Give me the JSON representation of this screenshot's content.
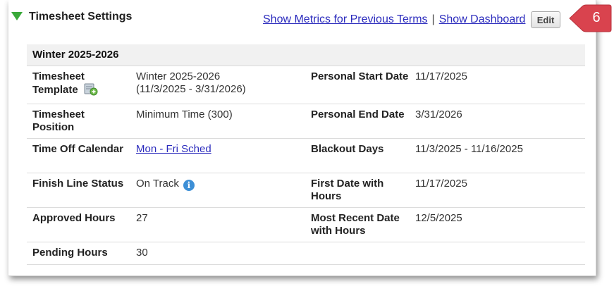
{
  "header": {
    "title": "Timesheet Settings",
    "link_metrics": "Show Metrics for Previous Terms",
    "separator": "|",
    "link_dashboard": "Show Dashboard",
    "edit_label": "Edit",
    "callout_number": "6",
    "callout_color": "#d9434e",
    "toggle_color": "#3aa93a"
  },
  "section": {
    "title": "Winter 2025-2026",
    "rows": [
      {
        "left_label": "Timesheet Template",
        "left_value_line1": "Winter 2025-2026",
        "left_value_line2": "(11/3/2025 - 3/31/2026)",
        "right_label": "Personal Start Date",
        "right_value": "11/17/2025"
      },
      {
        "left_label": "Timesheet Position",
        "left_value": "Minimum Time (300)",
        "right_label": "Personal End Date",
        "right_value": "3/31/2026"
      },
      {
        "left_label": "Time Off Calendar",
        "left_value": "Mon - Fri Sched",
        "right_label": "Blackout Days",
        "right_value": "11/3/2025 - 11/16/2025"
      },
      {
        "left_label": "Finish Line Status",
        "left_value": "On Track",
        "right_label": "First Date with Hours",
        "right_value": "11/17/2025"
      },
      {
        "left_label": "Approved Hours",
        "left_value": "27",
        "right_label": "Most Recent Date with Hours",
        "right_value": "12/5/2025"
      },
      {
        "left_label": "Pending Hours",
        "left_value": "30"
      }
    ]
  }
}
